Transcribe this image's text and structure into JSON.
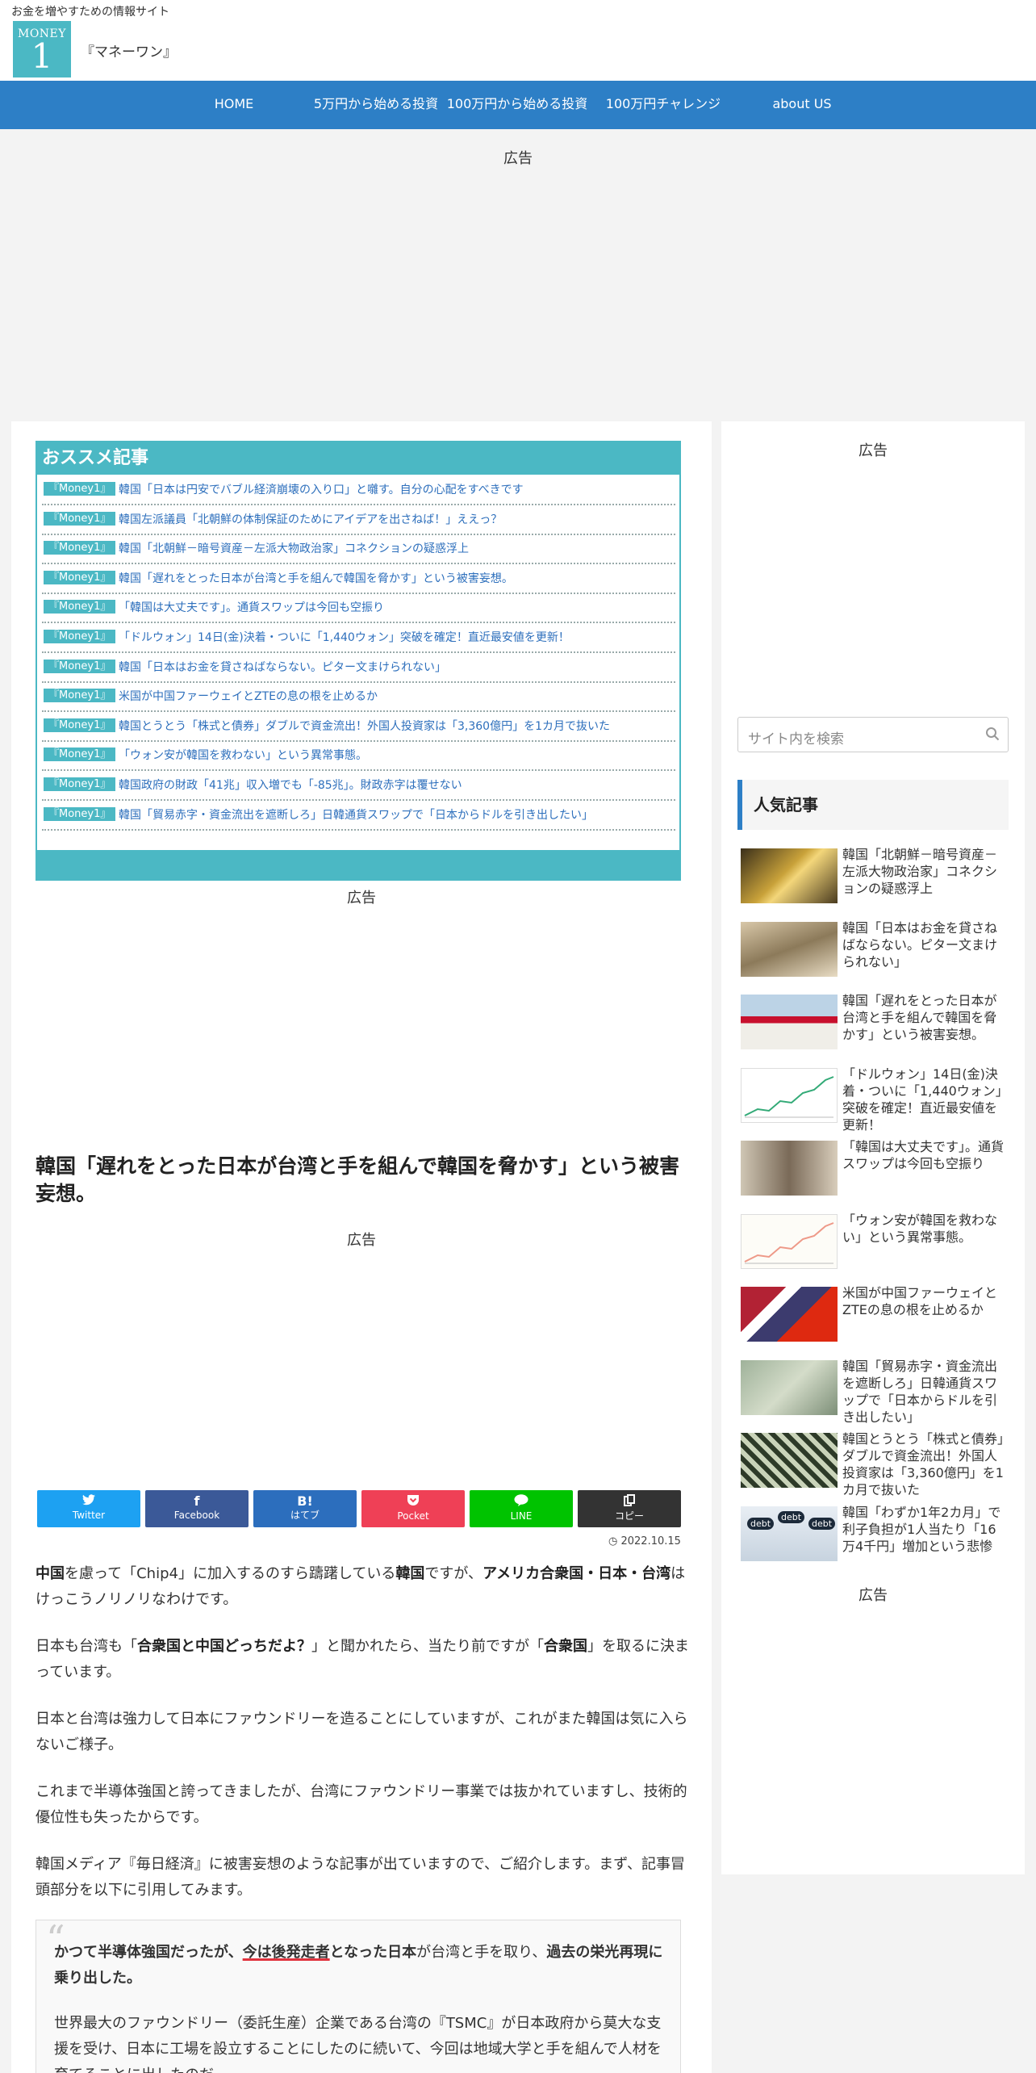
{
  "header": {
    "tagline": "お金を増やすための情報サイト",
    "logo_top": "MONEY",
    "logo_num": "1",
    "site_name": "『マネーワン』"
  },
  "nav": {
    "items": [
      "HOME",
      "5万円から始める投資",
      "100万円から始める投資",
      "100万円チャレンジ",
      "about US"
    ]
  },
  "ads": {
    "label": "広告"
  },
  "recommend": {
    "heading": "おススメ記事",
    "badge": "『Money1』",
    "items": [
      "韓国「日本は円安でバブル経済崩壊の入り口」と囃す。自分の心配をすべきです",
      "韓国左派議員「北朝鮮の体制保証のためにアイデアを出さねば！」ええっ？",
      "韓国「北朝鮮－暗号資産－左派大物政治家」コネクションの疑惑浮上",
      "韓国「遅れをとった日本が台湾と手を組んで韓国を脅かす」という被害妄想。",
      "「韓国は大丈夫です」。通貨スワップは今回も空振り",
      "「ドルウォン」14日(金)決着・ついに「1,440ウォン」突破を確定！直近最安値を更新！",
      "韓国「日本はお金を貸さねばならない。ピター文まけられない」",
      "米国が中国ファーウェイとZTEの息の根を止めるか",
      "韓国とうとう「株式と債券」ダブルで資金流出！外国人投資家は「3,360億円」を1カ月で抜いた",
      "「ウォン安が韓国を救わない」という異常事態。",
      "韓国政府の財政「41兆」収入増でも「-85兆」。財政赤字は覆せない",
      "韓国「貿易赤字・資金流出を遮断しろ」日韓通貨スワップで「日本からドルを引き出したい」"
    ]
  },
  "article": {
    "title": "韓国「遅れをとった日本が台湾と手を組んで韓国を脅かす」という被害妄想。",
    "date": "2022.10.15",
    "share": [
      {
        "label": "Twitter",
        "icon": "twitter-icon",
        "color": "#1da1f2"
      },
      {
        "label": "Facebook",
        "icon": "facebook-icon",
        "color": "#3b5998"
      },
      {
        "label": "はてブ",
        "icon": "hatebu-icon",
        "color": "#2c6ebd"
      },
      {
        "label": "Pocket",
        "icon": "pocket-icon",
        "color": "#ef4056"
      },
      {
        "label": "LINE",
        "icon": "line-icon",
        "color": "#00c300"
      },
      {
        "label": "コピー",
        "icon": "copy-icon",
        "color": "#333333"
      }
    ],
    "p1": {
      "a": "中国",
      "b": "を慮って「Chip4」に加入するのすら躊躇している",
      "c": "韓国",
      "d": "ですが、",
      "e": "アメリカ合衆国・日本・台湾",
      "f": "はけっこうノリノリなわけです。"
    },
    "p2": {
      "a": "日本も台湾も「",
      "b": "合衆国と中国どっちだよ？",
      "c": "」と聞かれたら、当たり前ですが「",
      "d": "合衆国",
      "e": "」を取るに決まっています。"
    },
    "p3": "日本と台湾は強力して日本にファウンドリーを造ることにしていますが、これがまた韓国は気に入らないご様子。",
    "p4": "これまで半導体強国と誇ってきましたが、台湾にファウンドリー事業では抜かれていますし、技術的優位性も失ったからです。",
    "p5": "韓国メディア『毎日経済』に被害妄想のような記事が出ていますので、ご紹介します。まず、記事冒頭部分を以下に引用してみます。",
    "quote": {
      "mark": "“",
      "a": "かつて半導体強国だったが、",
      "b": "今は後発走者",
      "c": "となった日本",
      "d": "が台湾と手を取り、",
      "e": "過去の栄光再現に乗り出した。",
      "p2": "世界最大のファウンドリー（委託生産）企業である台湾の『TSMC』が日本政府から莫大な支援を受け、日本に工場を設立することにしたのに続いて、今回は地域大学と手を組んで人材を育てることに出したのだ。"
    }
  },
  "sidebar": {
    "search_placeholder": "サイト内を検索",
    "popular_heading": "人気記事",
    "popular": [
      "韓国「北朝鮮－暗号資産－左派大物政治家」コネクションの疑惑浮上",
      "韓国「日本はお金を貸さねばならない。ピター文まけられない」",
      "韓国「遅れをとった日本が台湾と手を組んで韓国を脅かす」という被害妄想。",
      "「ドルウォン」14日(金)決着・ついに「1,440ウォン」突破を確定！直近最安値を更新！",
      "「韓国は大丈夫です」。通貨スワップは今回も空振り",
      "「ウォン安が韓国を救わない」という異常事態。",
      "米国が中国ファーウェイとZTEの息の根を止めるか",
      "韓国「貿易赤字・資金流出を遮断しろ」日韓通貨スワップで「日本からドルを引き出したい」",
      "韓国とうとう「株式と債券」ダブルで資金流出！外国人投資家は「3,360億円」を1カ月で抜いた",
      "韓国「わずか1年2カ月」で利子負担が1人当たり「16万4千円」増加という悲惨"
    ],
    "thumb_labels": [
      "debt",
      "debt",
      "debt"
    ]
  },
  "colors": {
    "accent": "#4bb8c4",
    "nav": "#2d7fc6",
    "link": "#2d6fbc"
  }
}
